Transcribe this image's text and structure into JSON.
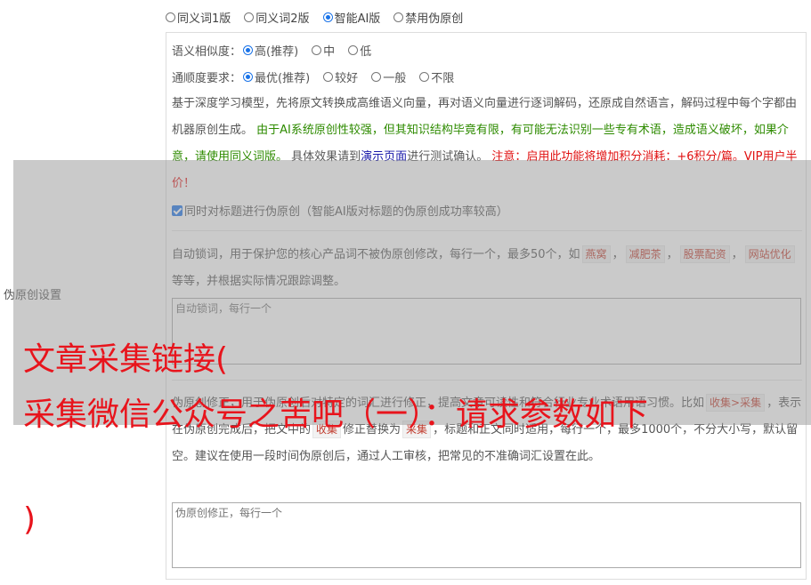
{
  "top_radios": [
    {
      "label": "同义词1版",
      "checked": false
    },
    {
      "label": "同义词2版",
      "checked": false
    },
    {
      "label": "智能AI版",
      "checked": true
    },
    {
      "label": "禁用伪原创",
      "checked": false
    }
  ],
  "side_label": "伪原创设置",
  "similarity": {
    "label": "语义相似度：",
    "options": [
      {
        "label": "高(推荐)",
        "checked": true
      },
      {
        "label": "中",
        "checked": false
      },
      {
        "label": "低",
        "checked": false
      }
    ]
  },
  "fluency": {
    "label": "通顺度要求：",
    "options": [
      {
        "label": "最优(推荐)",
        "checked": true
      },
      {
        "label": "较好",
        "checked": false
      },
      {
        "label": "一般",
        "checked": false
      },
      {
        "label": "不限",
        "checked": false
      }
    ]
  },
  "description": {
    "part1": "基于深度学习模型，先将原文转换成高维语义向量，再对语义向量进行逐词解码，还原成自然语言，解码过程中每个字都由机器原创生成。",
    "green": "由于AI系统原创性较强，但其知识结构毕竟有限，有可能无法识别一些专有术语，造成语义破坏，如果介意，请使用同义词版。",
    "part2": "具体效果请到",
    "link": "演示页面",
    "part3": "进行测试确认。",
    "red": "注意：启用此功能将增加积分消耗：+6积分/篇。VIP用户半价！"
  },
  "title_checkbox": {
    "label": "同时对标题进行伪原创（智能AI版对标题的伪原创成功率较高）",
    "checked": true
  },
  "lock_words": {
    "desc1": "自动锁词，用于保护您的核心产品词不被伪原创修改，每行一个，最多50个，如",
    "examples": [
      "燕窝",
      "减肥茶",
      "股票配资",
      "网站优化"
    ],
    "desc2": "等等，并根据实际情况跟踪调整。",
    "placeholder": "自动锁词，每行一个"
  },
  "correction": {
    "desc1": "伪原创修正，用于伪原创后对特定的词汇进行修正，提高文章可读性和符合行业专业术语用语习惯。比如",
    "example1": "收集>采集",
    "desc2": "，表示在伪原创完成后，把文中的",
    "example2": "收集",
    "desc3": "修正替换为",
    "example3": "采集",
    "desc4": "，标题和正文同时适用，每行一个，最多1000个，不分大小写，默认留空。建议在使用一段时间伪原创后，通过人工审核，把常见的不准确词汇设置在此。",
    "placeholder": "伪原创修正，每行一个"
  },
  "watermark": {
    "line1": "文章采集链接(",
    "line2": "采集微信公众号之苦吧（一）：请求参数如下",
    "line3": ")"
  },
  "colors": {
    "accent": "#1a73e8",
    "watermark": "#e8141c",
    "green": "#2e8b00",
    "red": "#e01010"
  }
}
